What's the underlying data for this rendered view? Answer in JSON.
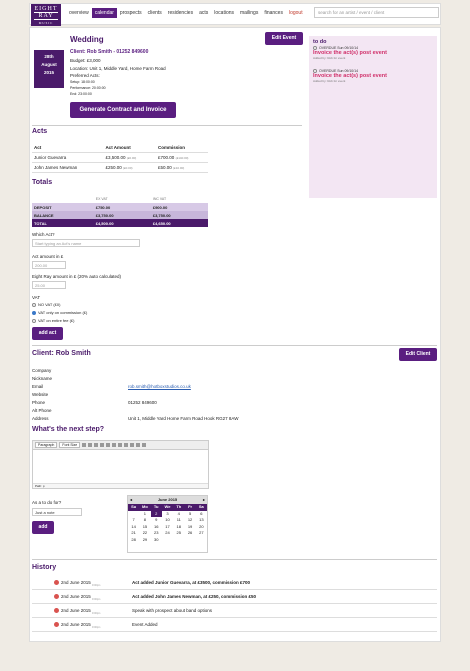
{
  "nav": {
    "logo_line1": "EIGHT",
    "logo_line2": "RAY",
    "logo_line3": "MUSIC",
    "items": [
      {
        "label": "overview"
      },
      {
        "label": "calendar"
      },
      {
        "label": "prospects"
      },
      {
        "label": "clients"
      },
      {
        "label": "residencies"
      },
      {
        "label": "acts"
      },
      {
        "label": "locations"
      },
      {
        "label": "mailings"
      },
      {
        "label": "finances"
      },
      {
        "label": "logout"
      }
    ],
    "search_placeholder": "search for an artist / event / client"
  },
  "event": {
    "title": "Wedding",
    "edit_label": "Edit Event",
    "date_day": "28th",
    "date_month": "August",
    "date_year": "2015",
    "client_line": "Client: Rob Smith - 01252 849600",
    "budget": "Budget: £3,000",
    "location": "Location: Unit 1, Middle Yard, Home Farm Road",
    "preferred_acts": "Preferred Acts:",
    "setup": "Setup: 18:00:00",
    "performance": "Performance: 20:00:00",
    "end": "End: 23:00:00",
    "generate_label": "Generate Contract and Invoice"
  },
  "todo": {
    "title": "to do",
    "items": [
      {
        "overdue": "OVERDUE Sun 09/10/14",
        "text": "Invoice the act(s) post event",
        "added": "Added by: Rob for event"
      },
      {
        "overdue": "OVERDUE Sun 09/10/14",
        "text": "Invoice the act(s) post event",
        "added": "Added by: Rob for event"
      }
    ]
  },
  "acts": {
    "heading": "Acts",
    "columns": [
      "Act",
      "Act Amount",
      "Commission"
    ],
    "rows": [
      {
        "act": "Junior Guevarra",
        "amount": "£3,500.00",
        "amount_sub": "(£0.00)",
        "commission": "£700.00",
        "commission_sub": "(£140.00)"
      },
      {
        "act": "John James Newman",
        "amount": "£250.00",
        "amount_sub": "(£0.00)",
        "commission": "£50.00",
        "commission_sub": "(£10.00)"
      }
    ]
  },
  "totals": {
    "heading": "Totals",
    "col_ex": "EX VAT",
    "col_inc": "INC VAT",
    "rows": [
      {
        "label": "DEPOSIT",
        "ex": "£750.00",
        "inc": "£900.00"
      },
      {
        "label": "BALANCE",
        "ex": "£3,750.00",
        "inc": "£3,750.00"
      },
      {
        "label": "TOTAL",
        "ex": "£4,500.00",
        "inc": "£4,650.00"
      }
    ]
  },
  "add_act": {
    "which_act_label": "Which Act?",
    "which_act_placeholder": "Start typing an Act's name",
    "amount_label": "Act amount in £",
    "amount_value": "200.00",
    "commission_label": "Eight Ray amount in £ (20% auto calculated)",
    "commission_value": "25.00",
    "vat_label": "VAT",
    "vat_options": [
      "NO VAT (£0)",
      "VAT only on commission (£)",
      "VAT on entire fee (£)"
    ],
    "button": "add act"
  },
  "client": {
    "heading": "Client: Rob Smith",
    "edit_label": "Edit Client",
    "fields": [
      {
        "label": "Company",
        "value": ""
      },
      {
        "label": "Nickname",
        "value": ""
      },
      {
        "label": "Email",
        "value": "rob.smith@hotboxstudios.co.uk"
      },
      {
        "label": "Website",
        "value": ""
      },
      {
        "label": "Phone",
        "value": "01252 849600"
      },
      {
        "label": "Alt Phone",
        "value": ""
      },
      {
        "label": "Address",
        "value": "Unit 1, Middle Yard Home Farm Road Hook RG27 8AW"
      }
    ]
  },
  "next_step": {
    "heading": "What's the next step?",
    "paragraph_select": "Paragraph",
    "fontsize_select": "Font Size",
    "path_label": "Path: p",
    "todo_question": "As a to do for?",
    "todo_select": "Just a note",
    "add_label": "add"
  },
  "calendar": {
    "month": "June 2015",
    "dow": [
      "Su",
      "Mo",
      "Tu",
      "We",
      "Th",
      "Fr",
      "Sa"
    ],
    "days": [
      "",
      "1",
      "2",
      "3",
      "4",
      "5",
      "6",
      "7",
      "8",
      "9",
      "10",
      "11",
      "12",
      "13",
      "14",
      "15",
      "16",
      "17",
      "18",
      "19",
      "20",
      "21",
      "22",
      "23",
      "24",
      "25",
      "26",
      "27",
      "28",
      "29",
      "30",
      "",
      "",
      "",
      ""
    ],
    "selected": "2"
  },
  "history": {
    "heading": "History",
    "items": [
      {
        "date": "2nd June 2015",
        "sub": "9:00pm",
        "msg": "Act added Junior Guevarra, at £3500, commission £700",
        "bold": true
      },
      {
        "date": "2nd June 2015",
        "sub": "9:00pm",
        "msg": "Act added John James Newman, at £250, commission £50",
        "bold": true
      },
      {
        "date": "2nd June 2015",
        "sub": "9:00pm",
        "msg": "Speak with prospect about band options",
        "bold": false
      },
      {
        "date": "2nd June 2015",
        "sub": "9:00pm",
        "msg": "Event Added",
        "bold": false
      }
    ]
  }
}
